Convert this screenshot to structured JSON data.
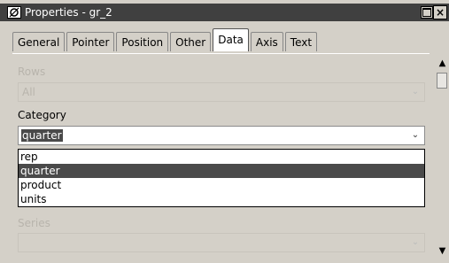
{
  "window": {
    "title": "Properties - gr_2",
    "close_glyph": "×"
  },
  "tabs": [
    {
      "label": "General",
      "active": false
    },
    {
      "label": "Pointer",
      "active": false
    },
    {
      "label": "Position",
      "active": false
    },
    {
      "label": "Other",
      "active": false
    },
    {
      "label": "Data",
      "active": true
    },
    {
      "label": "Axis",
      "active": false
    },
    {
      "label": "Text",
      "active": false
    }
  ],
  "rows": {
    "label": "Rows",
    "value": "All",
    "enabled": false
  },
  "category": {
    "label": "Category",
    "value": "quarter",
    "expanded": true,
    "options": [
      "rep",
      "quarter",
      "product",
      "units"
    ],
    "selected_option": "quarter"
  },
  "series": {
    "label": "Series",
    "value": "",
    "enabled": false
  },
  "colors": {
    "selection": "#4a4a4a",
    "titlebar": "#404040",
    "dialog": "#d4d0c8",
    "disabled_text": "#b8b4ac"
  },
  "icons": {
    "app": "properties-app-icon",
    "dropdown": "chevron-down-icon",
    "scroll_up": "caret-up-icon",
    "scroll_down": "caret-down-icon"
  }
}
